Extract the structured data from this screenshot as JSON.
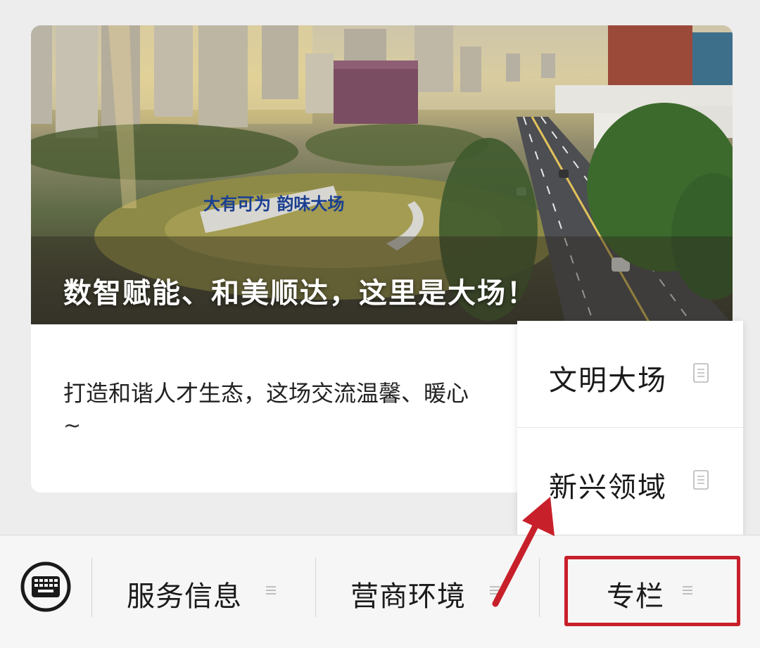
{
  "article": {
    "title": "数智赋能、和美顺达，这里是大场！",
    "summary": "打造和谐人才生态，这场交流温馨、暖心",
    "summary_tail": "~",
    "sign_text": "大有可为 韵味大场"
  },
  "submenu": {
    "items": [
      {
        "label": "文明大场",
        "icon": "document-icon"
      },
      {
        "label": "新兴领域",
        "icon": "document-icon"
      }
    ]
  },
  "menu_bar": {
    "keyboard_icon": "keyboard-icon",
    "items": [
      {
        "label": "服务信息",
        "icon": "menu-lines-icon"
      },
      {
        "label": "营商环境",
        "icon": "menu-lines-icon"
      },
      {
        "label": "专栏",
        "icon": "menu-lines-icon"
      }
    ]
  },
  "colors": {
    "annotation_red": "#c8202a",
    "background": "#ededed",
    "card": "#ffffff"
  }
}
